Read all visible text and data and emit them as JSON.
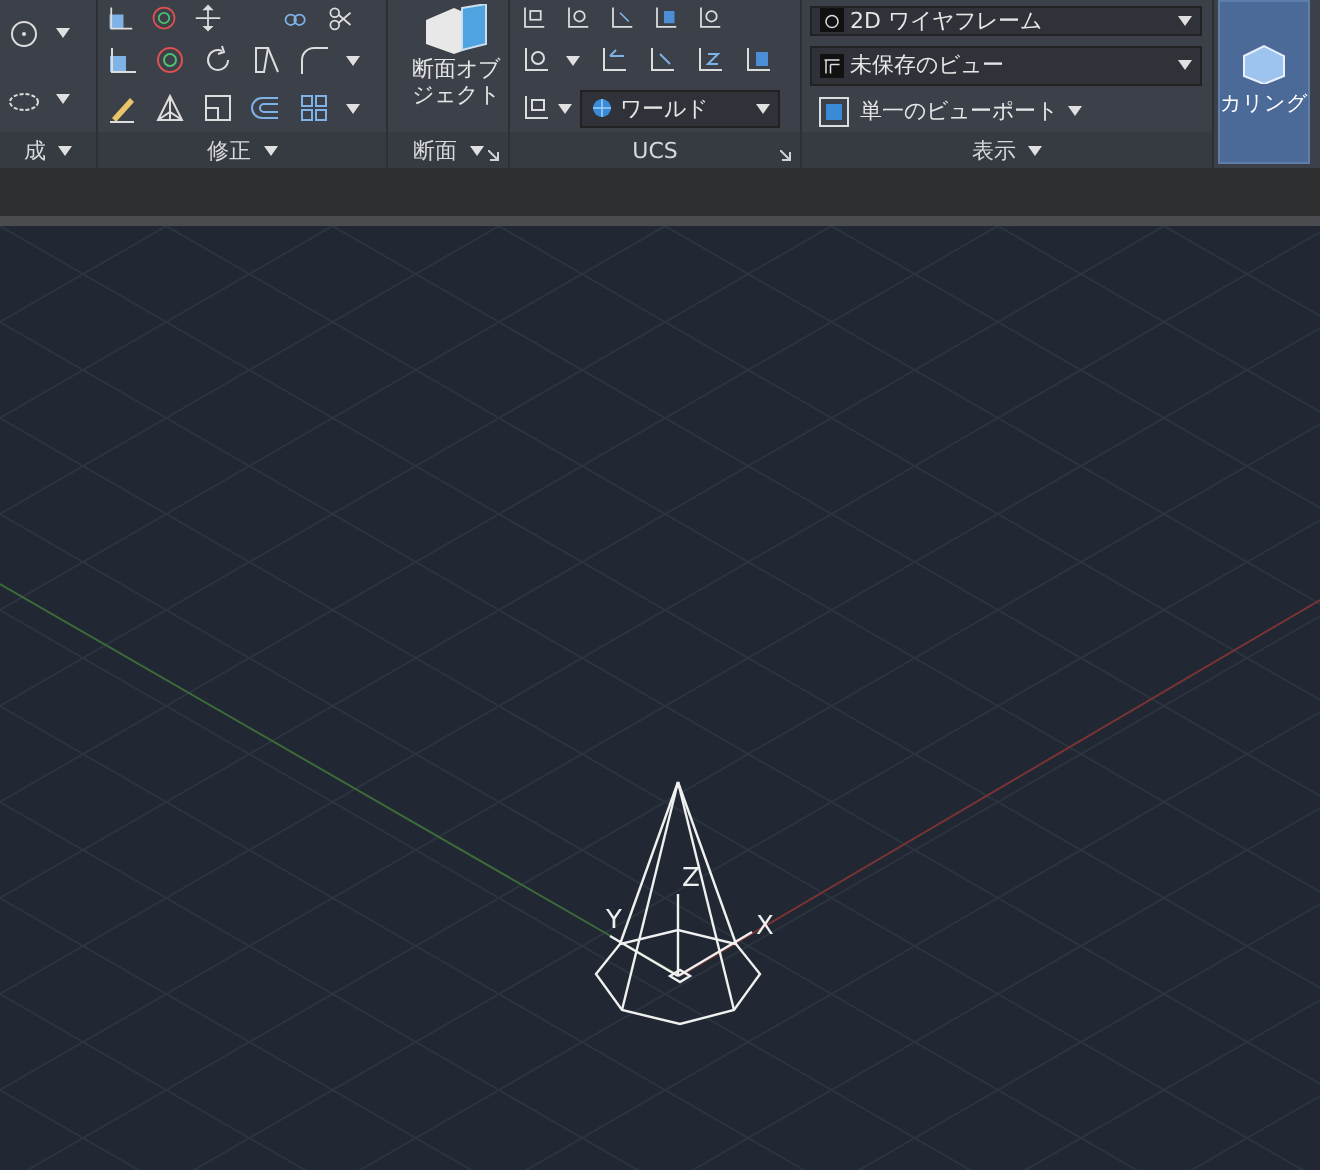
{
  "ribbon": {
    "panels": [
      {
        "title": "成",
        "menu": true,
        "launcher": false
      },
      {
        "title": "修正",
        "menu": true,
        "launcher": false
      },
      {
        "title": "断面",
        "menu": true,
        "launcher": true
      },
      {
        "title": "UCS",
        "menu": false,
        "launcher": true
      },
      {
        "title": "表示",
        "menu": true,
        "launcher": false
      }
    ],
    "section_button": {
      "label": "断面オブジェクト"
    },
    "ucs_dropdown": {
      "value": "ワールド"
    },
    "view_dropdowns": [
      {
        "value": "2D ワイヤフレーム"
      },
      {
        "value": "未保存のビュー"
      }
    ],
    "viewport_button": {
      "label": "単一のビューポート"
    },
    "culling_button": {
      "label": "カリング",
      "selected": true
    }
  },
  "viewport": {
    "axis_labels": [
      "Z",
      "Y",
      "X"
    ]
  }
}
